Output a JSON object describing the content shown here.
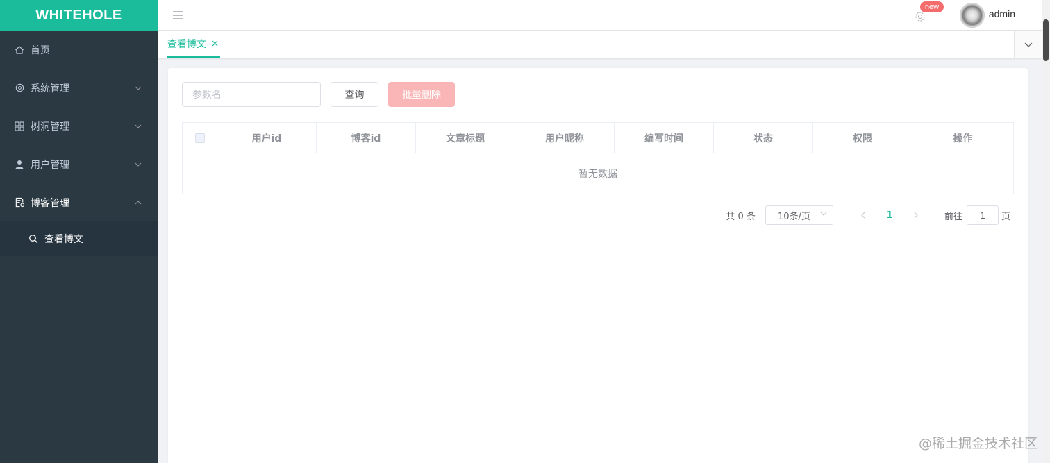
{
  "app": {
    "logo": "WHITEHOLE"
  },
  "sidebar": {
    "items": [
      {
        "label": "首页",
        "icon": "home-icon"
      },
      {
        "label": "系统管理",
        "icon": "gear-icon",
        "expandable": true
      },
      {
        "label": "树洞管理",
        "icon": "grid-icon",
        "expandable": true
      },
      {
        "label": "用户管理",
        "icon": "user-icon",
        "expandable": true
      },
      {
        "label": "博客管理",
        "icon": "document-icon",
        "expandable": true,
        "expanded": true,
        "children": [
          {
            "label": "查看博文",
            "icon": "search-icon",
            "active": true
          }
        ]
      }
    ]
  },
  "header": {
    "settings_badge": "new",
    "username": "admin"
  },
  "tabs": [
    {
      "label": "查看博文",
      "active": true
    }
  ],
  "toolbar": {
    "search_placeholder": "参数名",
    "query_label": "查询",
    "batch_delete_label": "批量删除"
  },
  "table": {
    "columns": [
      "用户id",
      "博客id",
      "文章标题",
      "用户昵称",
      "编写时间",
      "状态",
      "权限",
      "操作"
    ],
    "rows": [],
    "empty_text": "暂无数据"
  },
  "pagination": {
    "total_text": "共 0 条",
    "page_size": "10条/页",
    "current_page": "1",
    "goto_label": "前往",
    "goto_value": "1",
    "goto_suffix": "页"
  },
  "watermark": "@稀土掘金技术社区",
  "colors": {
    "accent": "#1abc9c",
    "sidebar_bg": "#2b3a42",
    "danger_disabled": "#fab6b6",
    "badge": "#f56c6c"
  }
}
